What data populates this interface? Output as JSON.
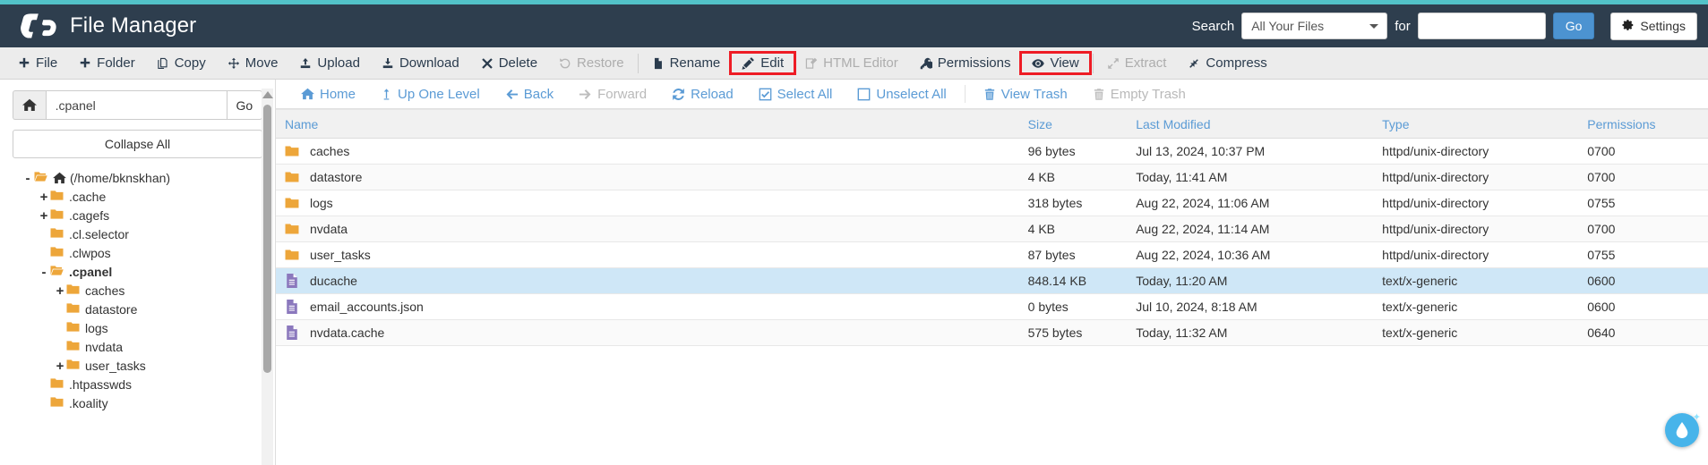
{
  "header": {
    "title": "File Manager",
    "logo_icon": "cpanel-logo-icon",
    "search_label": "Search",
    "search_scope": "All Your Files",
    "search_for_label": "for",
    "search_value": "",
    "search_placeholder": "",
    "go_label": "Go",
    "settings_label": "Settings",
    "settings_icon": "gear-icon",
    "accent_color": "#52c2c8",
    "background_color": "#2e3e4e"
  },
  "toolbar": {
    "highlight_color": "#ee1c25",
    "items": [
      {
        "label": "File",
        "icon": "plus-icon",
        "disabled": false,
        "highlighted": false,
        "sep_after": false
      },
      {
        "label": "Folder",
        "icon": "plus-icon",
        "disabled": false,
        "highlighted": false,
        "sep_after": false
      },
      {
        "label": "Copy",
        "icon": "copy-icon",
        "disabled": false,
        "highlighted": false,
        "sep_after": false
      },
      {
        "label": "Move",
        "icon": "move-icon",
        "disabled": false,
        "highlighted": false,
        "sep_after": false
      },
      {
        "label": "Upload",
        "icon": "upload-icon",
        "disabled": false,
        "highlighted": false,
        "sep_after": false
      },
      {
        "label": "Download",
        "icon": "download-icon",
        "disabled": false,
        "highlighted": false,
        "sep_after": false
      },
      {
        "label": "Delete",
        "icon": "x-icon",
        "disabled": false,
        "highlighted": false,
        "sep_after": false
      },
      {
        "label": "Restore",
        "icon": "restore-icon",
        "disabled": true,
        "highlighted": false,
        "sep_after": true
      },
      {
        "label": "Rename",
        "icon": "file-icon",
        "disabled": false,
        "highlighted": false,
        "sep_after": false
      },
      {
        "label": "Edit",
        "icon": "pencil-icon",
        "disabled": false,
        "highlighted": true,
        "sep_after": false
      },
      {
        "label": "HTML Editor",
        "icon": "html-editor-icon",
        "disabled": true,
        "highlighted": false,
        "sep_after": false
      },
      {
        "label": "Permissions",
        "icon": "key-icon",
        "disabled": false,
        "highlighted": false,
        "sep_after": false
      },
      {
        "label": "View",
        "icon": "eye-icon",
        "disabled": false,
        "highlighted": true,
        "sep_after": true
      },
      {
        "label": "Extract",
        "icon": "extract-icon",
        "disabled": true,
        "highlighted": false,
        "sep_after": false
      },
      {
        "label": "Compress",
        "icon": "compress-icon",
        "disabled": false,
        "highlighted": false,
        "sep_after": false
      }
    ]
  },
  "sidebar": {
    "home_icon": "home-icon",
    "path_value": ".cpanel",
    "path_placeholder": "",
    "go_label": "Go",
    "collapse_all_label": "Collapse All",
    "tree": [
      {
        "label": "(/home/bknskhan)",
        "toggle": "-",
        "indent": 0,
        "open": true,
        "home": true,
        "active": false
      },
      {
        "label": ".cache",
        "toggle": "+",
        "indent": 1,
        "open": false,
        "home": false,
        "active": false
      },
      {
        "label": ".cagefs",
        "toggle": "+",
        "indent": 1,
        "open": false,
        "home": false,
        "active": false
      },
      {
        "label": ".cl.selector",
        "toggle": "",
        "indent": 1,
        "open": false,
        "home": false,
        "active": false
      },
      {
        "label": ".clwpos",
        "toggle": "",
        "indent": 1,
        "open": false,
        "home": false,
        "active": false
      },
      {
        "label": ".cpanel",
        "toggle": "-",
        "indent": 1,
        "open": true,
        "home": false,
        "active": true
      },
      {
        "label": "caches",
        "toggle": "+",
        "indent": 2,
        "open": false,
        "home": false,
        "active": false
      },
      {
        "label": "datastore",
        "toggle": "",
        "indent": 2,
        "open": false,
        "home": false,
        "active": false
      },
      {
        "label": "logs",
        "toggle": "",
        "indent": 2,
        "open": false,
        "home": false,
        "active": false
      },
      {
        "label": "nvdata",
        "toggle": "",
        "indent": 2,
        "open": false,
        "home": false,
        "active": false
      },
      {
        "label": "user_tasks",
        "toggle": "+",
        "indent": 2,
        "open": false,
        "home": false,
        "active": false
      },
      {
        "label": ".htpasswds",
        "toggle": "",
        "indent": 1,
        "open": false,
        "home": false,
        "active": false
      },
      {
        "label": ".koality",
        "toggle": "",
        "indent": 1,
        "open": false,
        "home": false,
        "active": false
      }
    ]
  },
  "navbar": {
    "items": [
      {
        "label": "Home",
        "icon": "home-icon",
        "disabled": false,
        "sep_after": false
      },
      {
        "label": "Up One Level",
        "icon": "up-arrow-icon",
        "disabled": false,
        "sep_after": false
      },
      {
        "label": "Back",
        "icon": "left-arrow-icon",
        "disabled": false,
        "sep_after": false
      },
      {
        "label": "Forward",
        "icon": "right-arrow-icon",
        "disabled": true,
        "sep_after": false
      },
      {
        "label": "Reload",
        "icon": "reload-icon",
        "disabled": false,
        "sep_after": false
      },
      {
        "label": "Select All",
        "icon": "checkbox-checked-icon",
        "disabled": false,
        "sep_after": false
      },
      {
        "label": "Unselect All",
        "icon": "checkbox-empty-icon",
        "disabled": false,
        "sep_after": true
      },
      {
        "label": "View Trash",
        "icon": "trash-icon",
        "disabled": false,
        "sep_after": false
      },
      {
        "label": "Empty Trash",
        "icon": "trash-icon",
        "disabled": true,
        "sep_after": false
      }
    ]
  },
  "filelist": {
    "columns": [
      "Name",
      "Size",
      "Last Modified",
      "Type",
      "Permissions"
    ],
    "rows": [
      {
        "name": "caches",
        "size": "96 bytes",
        "modified": "Jul 13, 2024, 10:37 PM",
        "type": "httpd/unix-directory",
        "permissions": "0700",
        "icon": "folder-icon",
        "selected": false
      },
      {
        "name": "datastore",
        "size": "4 KB",
        "modified": "Today, 11:41 AM",
        "type": "httpd/unix-directory",
        "permissions": "0700",
        "icon": "folder-icon",
        "selected": false
      },
      {
        "name": "logs",
        "size": "318 bytes",
        "modified": "Aug 22, 2024, 11:06 AM",
        "type": "httpd/unix-directory",
        "permissions": "0755",
        "icon": "folder-icon",
        "selected": false
      },
      {
        "name": "nvdata",
        "size": "4 KB",
        "modified": "Aug 22, 2024, 11:14 AM",
        "type": "httpd/unix-directory",
        "permissions": "0700",
        "icon": "folder-icon",
        "selected": false
      },
      {
        "name": "user_tasks",
        "size": "87 bytes",
        "modified": "Aug 22, 2024, 10:36 AM",
        "type": "httpd/unix-directory",
        "permissions": "0755",
        "icon": "folder-icon",
        "selected": false
      },
      {
        "name": "ducache",
        "size": "848.14 KB",
        "modified": "Today, 11:20 AM",
        "type": "text/x-generic",
        "permissions": "0600",
        "icon": "file-text-icon",
        "selected": true
      },
      {
        "name": "email_accounts.json",
        "size": "0 bytes",
        "modified": "Jul 10, 2024, 8:18 AM",
        "type": "text/x-generic",
        "permissions": "0600",
        "icon": "file-text-icon",
        "selected": false
      },
      {
        "name": "nvdata.cache",
        "size": "575 bytes",
        "modified": "Today, 11:32 AM",
        "type": "text/x-generic",
        "permissions": "0640",
        "icon": "file-text-icon",
        "selected": false
      }
    ],
    "selected_row_color": "#cfe7f7",
    "folder_icon_color": "#eda63a",
    "file_icon_color": "#8b78bd"
  },
  "widget": {
    "icon": "water-drop-icon",
    "color": "#47b4ea"
  }
}
